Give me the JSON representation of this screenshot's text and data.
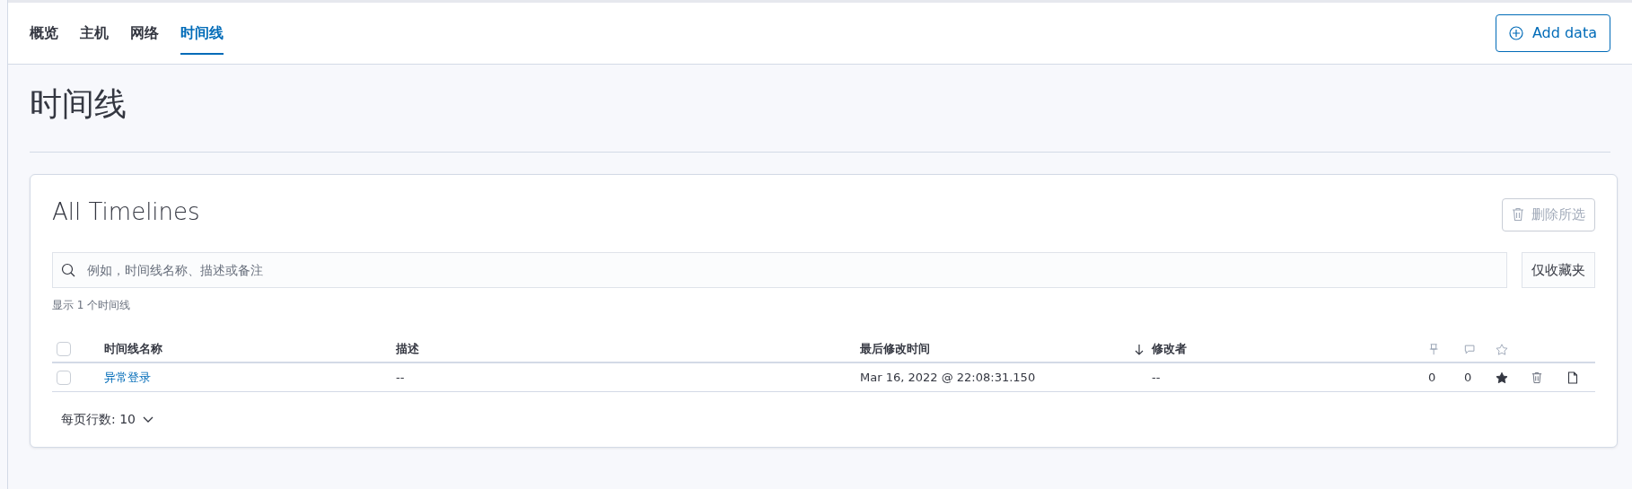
{
  "tabs": [
    {
      "label": "概览",
      "selected": false
    },
    {
      "label": "主机",
      "selected": false
    },
    {
      "label": "网络",
      "selected": false
    },
    {
      "label": "时间线",
      "selected": true
    }
  ],
  "add_button": {
    "label": "Add data"
  },
  "page_title": "时间线",
  "card": {
    "title": "All Timelines",
    "delete_button": {
      "label": "删除所选",
      "disabled": true
    },
    "search": {
      "placeholder": "例如，时间线名称、描述或备注"
    },
    "favorites_button": {
      "label": "仅收藏夹"
    },
    "count": "显示 1 个时间线",
    "select_all": {
      "checked": false
    },
    "columns": [
      {
        "label": "时间线名称"
      },
      {
        "label": "描述"
      },
      {
        "label": "最后修改时间",
        "sorted_descending": true
      },
      {
        "label": "修改者"
      }
    ],
    "rows": [
      {
        "checked": false,
        "name": "异常登录",
        "description": "--",
        "modified": "Mar 16, 2022 @ 22:08:31.150",
        "modified_by": "--",
        "pinned": "0",
        "notes": "0",
        "favorite": true
      }
    ],
    "rows_per_page": "每页行数: 10"
  }
}
